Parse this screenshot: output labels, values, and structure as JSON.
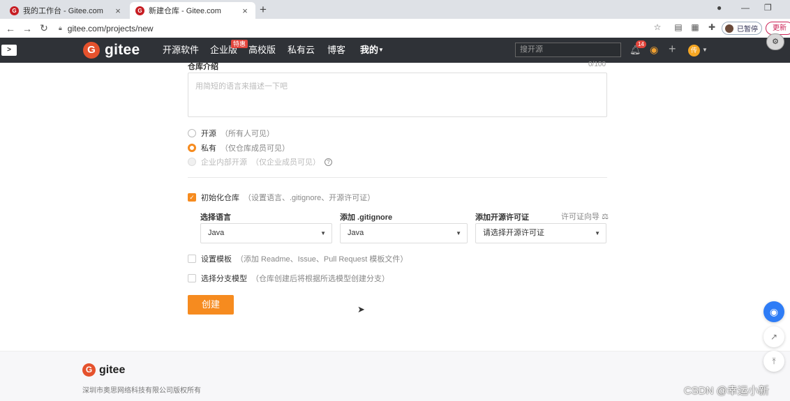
{
  "browser": {
    "tabs": [
      {
        "label": "我的工作台 - Gitee.com",
        "favicon": "gitee-favicon"
      },
      {
        "label": "新建仓库 - Gitee.com",
        "favicon": "gitee-favicon"
      }
    ],
    "url": "gitee.com/projects/new",
    "profile_status": "已暂停",
    "update_label": "更新"
  },
  "header": {
    "logo_text": "gitee",
    "nav": [
      "开源软件",
      "企业版",
      "高校版",
      "私有云",
      "博客",
      "我的"
    ],
    "enterprise_badge": "特惠",
    "search_placeholder": "搜开源",
    "notification_count": "14",
    "avatar_text": "传",
    "accent_color": "#e5522d"
  },
  "form": {
    "intro_label": "仓库介绍",
    "intro_counter": "0/100",
    "intro_placeholder": "用简短的语言来描述一下吧",
    "visibility": [
      {
        "label": "开源",
        "hint": "（所有人可见）",
        "selected": false
      },
      {
        "label": "私有",
        "hint": "（仅仓库成员可见）",
        "selected": true
      },
      {
        "label": "企业内部开源",
        "hint": "（仅企业成员可见）",
        "selected": false,
        "disabled": true
      }
    ],
    "init_repo": {
      "label": "初始化仓库",
      "hint": "（设置语言、.gitignore、开源许可证）",
      "checked": true
    },
    "language_label": "选择语言",
    "language_value": "Java",
    "gitignore_label": "添加 .gitignore",
    "gitignore_value": "Java",
    "license_label": "添加开源许可证",
    "license_help": "许可证向导",
    "license_value": "请选择开源许可证",
    "template": {
      "label": "设置模板",
      "hint": "（添加 Readme、Issue、Pull Request 模板文件）",
      "checked": false
    },
    "branch_model": {
      "label": "选择分支模型",
      "hint": "（仓库创建后将根据所选模型创建分支）",
      "checked": false
    },
    "create_label": "创建",
    "button_color": "#f68b1f"
  },
  "footer": {
    "logo_text": "gitee",
    "copyright": "深圳市奥思网络科技有限公司版权所有",
    "watermark": "CSDN @幸运小新"
  }
}
